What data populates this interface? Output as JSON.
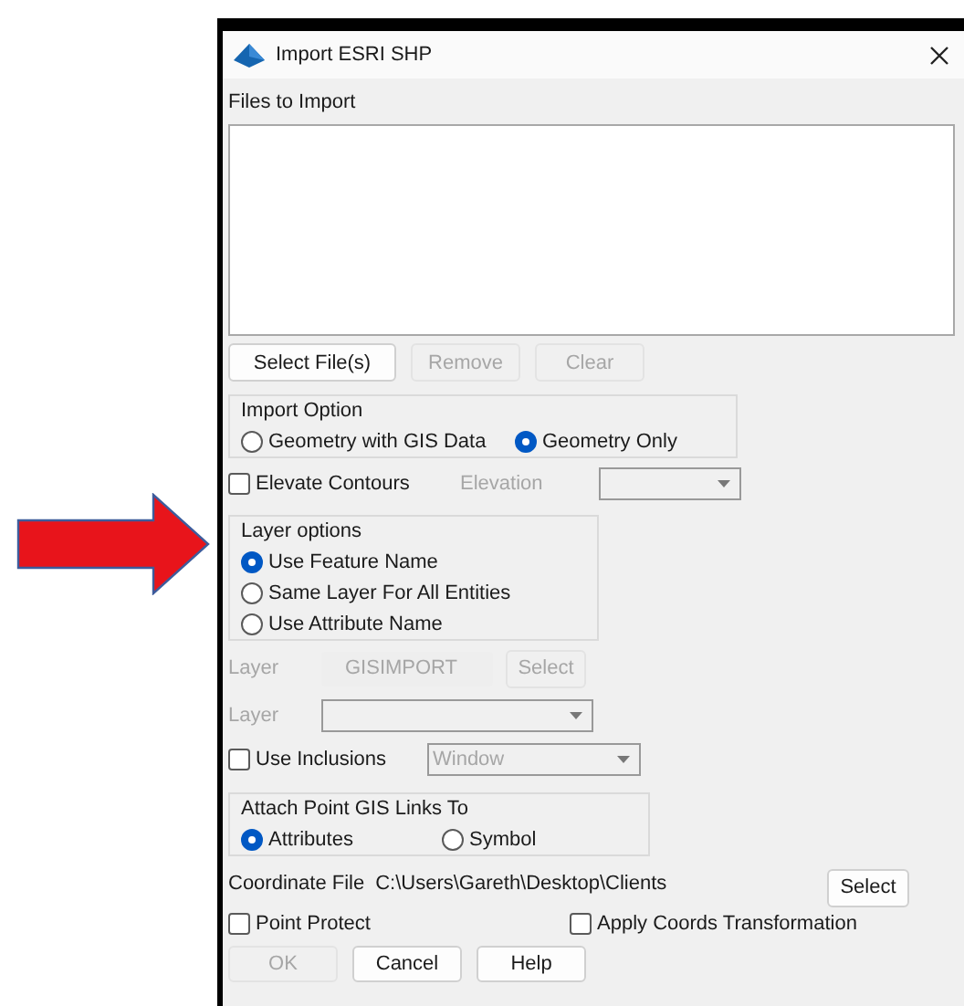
{
  "window": {
    "title": "Import ESRI SHP"
  },
  "files": {
    "label": "Files to Import"
  },
  "file_buttons": [
    {
      "label": "Select File(s)",
      "disabled": false
    },
    {
      "label": "Remove",
      "disabled": true
    },
    {
      "label": "Clear",
      "disabled": true
    }
  ],
  "import_option": {
    "title": "Import Option",
    "options": [
      {
        "label": "Geometry with GIS Data",
        "selected": false
      },
      {
        "label": "Geometry Only",
        "selected": true
      }
    ]
  },
  "elevate_contours": {
    "label": "Elevate Contours",
    "checked": false
  },
  "elevation": {
    "label": "Elevation",
    "disabled": true
  },
  "layer_options": {
    "title": "Layer options",
    "options": [
      {
        "label": "Use Feature Name",
        "selected": true
      },
      {
        "label": "Same Layer For All Entities",
        "selected": false
      },
      {
        "label": "Use Attribute Name",
        "selected": false
      }
    ]
  },
  "layer_name": {
    "label": "Layer",
    "value": "GISIMPORT",
    "button": "Select",
    "disabled": true
  },
  "layer_select": {
    "label": "Layer",
    "disabled": true
  },
  "use_inclusions": {
    "label": "Use Inclusions",
    "checked": false,
    "dropdown_value": "Window",
    "disabled": true
  },
  "attach_links": {
    "title": "Attach Point GIS Links To",
    "options": [
      {
        "label": "Attributes",
        "selected": true
      },
      {
        "label": "Symbol",
        "selected": false
      }
    ]
  },
  "coordinate_file": {
    "label": "Coordinate File",
    "path": "C:\\Users\\Gareth\\Desktop\\Clients",
    "button": "Select"
  },
  "point_protect": {
    "label": "Point Protect",
    "checked": false
  },
  "apply_coords": {
    "label": "Apply Coords Transformation",
    "checked": false
  },
  "dialog_buttons": [
    {
      "label": "OK",
      "disabled": true
    },
    {
      "label": "Cancel",
      "disabled": false
    },
    {
      "label": "Help",
      "disabled": false
    }
  ]
}
